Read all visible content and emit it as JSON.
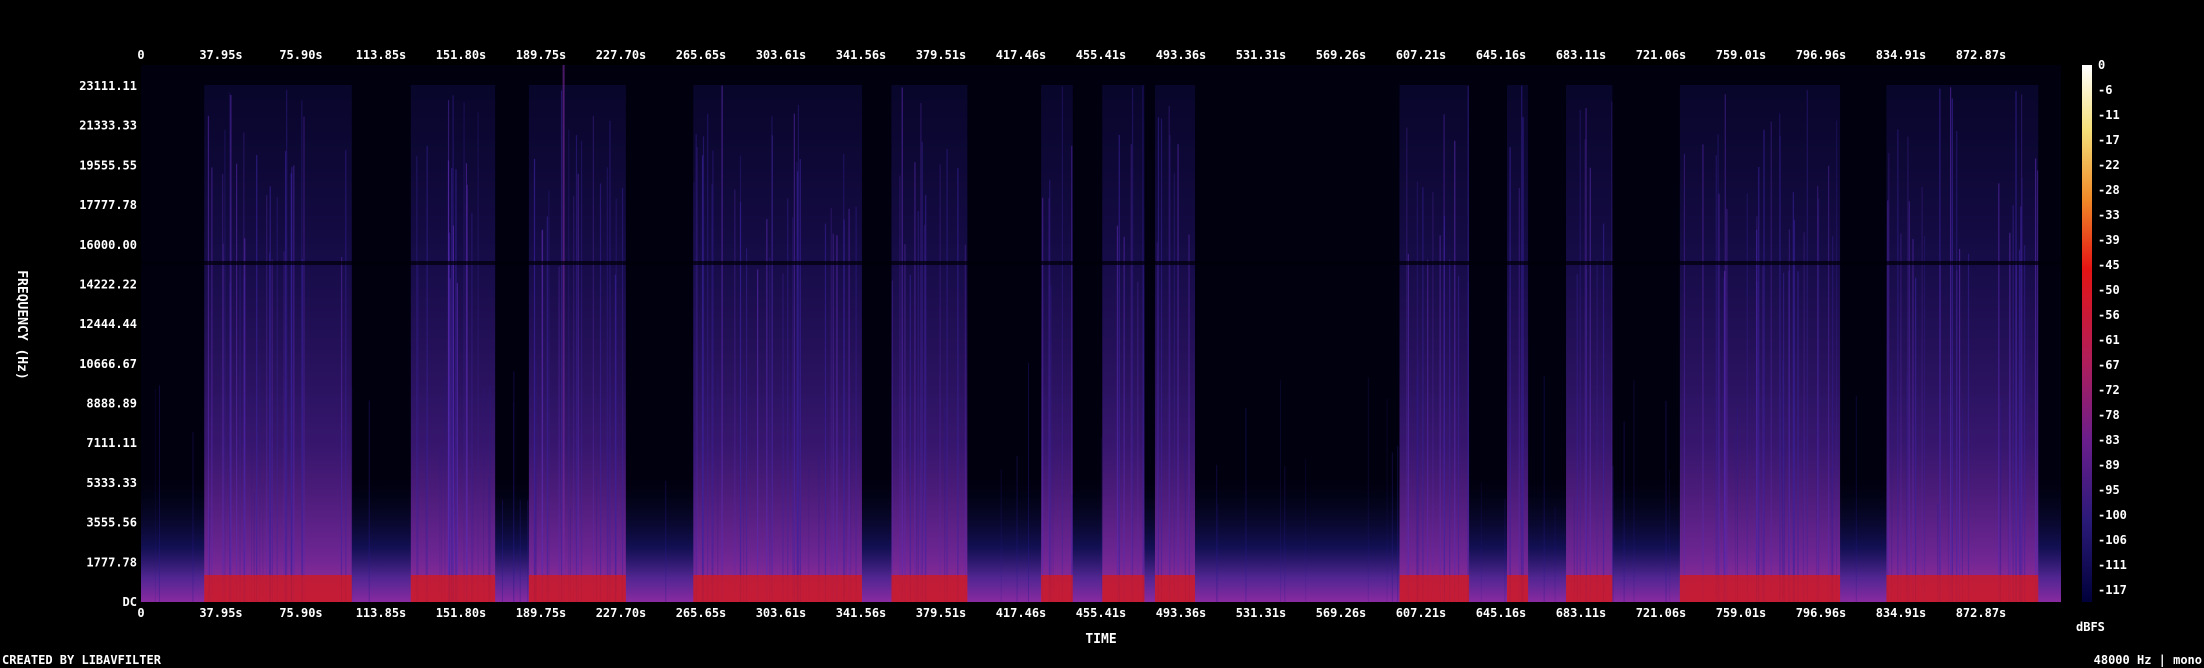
{
  "chart_data": {
    "type": "heatmap",
    "title": "",
    "xlabel": "TIME",
    "ylabel": "FREQUENCY (Hz)",
    "colorbar_label": "dBFS",
    "footer_left": "CREATED BY LIBAVFILTER",
    "footer_right": "48000 Hz | mono",
    "x_ticks": [
      "0",
      "37.95s",
      "75.90s",
      "113.85s",
      "151.80s",
      "189.75s",
      "227.70s",
      "265.65s",
      "303.61s",
      "341.56s",
      "379.51s",
      "417.46s",
      "455.41s",
      "493.36s",
      "531.31s",
      "569.26s",
      "607.21s",
      "645.16s",
      "683.11s",
      "721.06s",
      "759.01s",
      "796.96s",
      "834.91s",
      "872.87s"
    ],
    "y_ticks": [
      "23111.11",
      "21333.33",
      "19555.55",
      "17777.78",
      "16000.00",
      "14222.22",
      "12444.44",
      "10666.67",
      "8888.89",
      "7111.11",
      "5333.33",
      "3555.56",
      "1777.78",
      "DC"
    ],
    "colorbar_ticks": [
      "0",
      "-6",
      "-11",
      "-17",
      "-22",
      "-28",
      "-33",
      "-39",
      "-45",
      "-50",
      "-56",
      "-61",
      "-67",
      "-72",
      "-78",
      "-83",
      "-89",
      "-95",
      "-100",
      "-106",
      "-111",
      "-117"
    ],
    "xlim": [
      0,
      910.8
    ],
    "ylim": [
      0,
      24000
    ],
    "colorbar_range": [
      -120,
      0
    ],
    "active_segments_s": [
      [
        30,
        100
      ],
      [
        128,
        168
      ],
      [
        184,
        230
      ],
      [
        262,
        342
      ],
      [
        356,
        392
      ],
      [
        427,
        442
      ],
      [
        456,
        476
      ],
      [
        481,
        500
      ],
      [
        597,
        630
      ],
      [
        648,
        658
      ],
      [
        676,
        698
      ],
      [
        730,
        806
      ],
      [
        828,
        900
      ]
    ],
    "colors": {
      "background": "#000000",
      "text": "#ffffff",
      "quiet": "#00000f",
      "low": "#14145a",
      "mid": "#6e2896",
      "high": "#e61414",
      "peak": "#ffffff"
    }
  }
}
